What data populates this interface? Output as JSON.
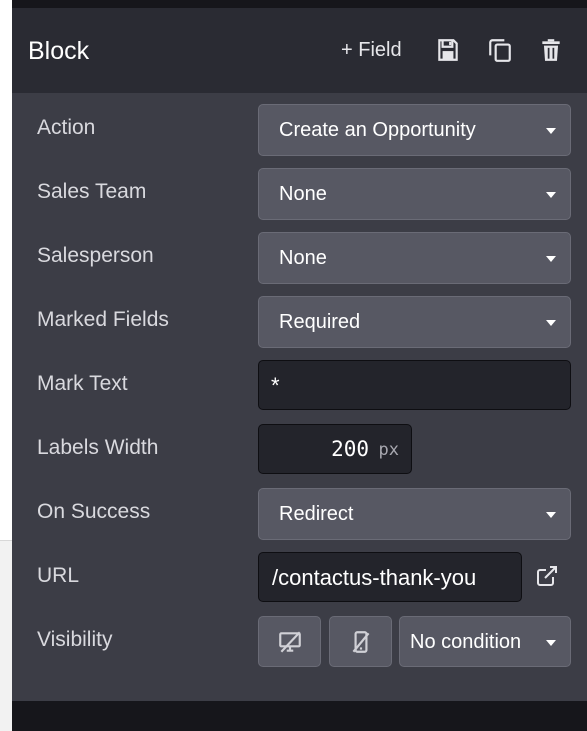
{
  "header": {
    "title": "Block",
    "add_field_label": "+ Field"
  },
  "fields": {
    "action": {
      "label": "Action",
      "value": "Create an Opportunity"
    },
    "sales_team": {
      "label": "Sales Team",
      "value": "None"
    },
    "salesperson": {
      "label": "Salesperson",
      "value": "None"
    },
    "marked_fields": {
      "label": "Marked Fields",
      "value": "Required"
    },
    "mark_text": {
      "label": "Mark Text",
      "value": "*"
    },
    "labels_width": {
      "label": "Labels Width",
      "value": "200",
      "unit": "px"
    },
    "on_success": {
      "label": "On Success",
      "value": "Redirect"
    },
    "url": {
      "label": "URL",
      "value": "/contactus-thank-you"
    },
    "visibility": {
      "label": "Visibility",
      "value": "No condition"
    }
  },
  "icons": {
    "save": "floppy-disk-icon",
    "duplicate": "copy-icon",
    "delete": "trash-icon",
    "open_url": "external-link-icon",
    "hide_desktop": "desktop-hidden-icon",
    "hide_mobile": "mobile-hidden-icon"
  },
  "colors": {
    "panel_bg": "#3c3d46",
    "header_bg": "#2a2b33",
    "select_bg": "#575863",
    "input_bg": "#23242b"
  }
}
